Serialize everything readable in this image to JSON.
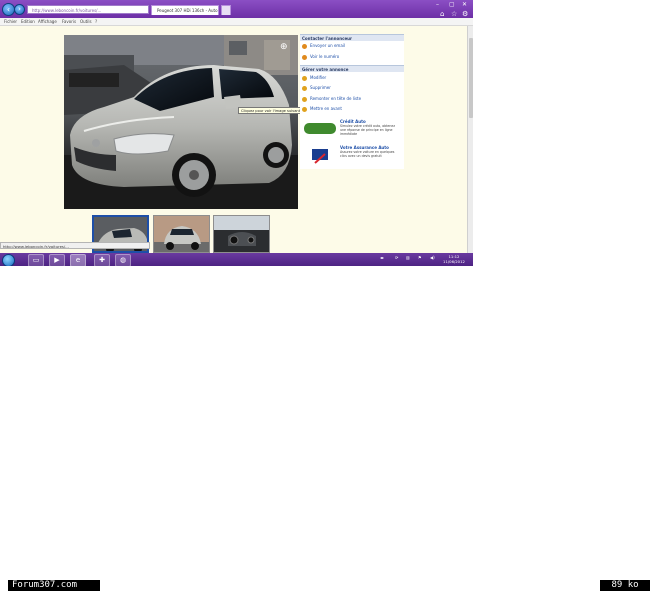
{
  "browser": {
    "address": "http://www.leboncoin.fr/voitures/...",
    "tabs": [
      {
        "label": "Peugeot 307 HDi 136ch - Auto"
      },
      {
        "label": ""
      }
    ],
    "window_controls": [
      "–",
      "▢",
      "✕"
    ]
  },
  "menu": [
    "Fichier",
    "Edition",
    "Affichage",
    "Favoris",
    "Outils",
    "?"
  ],
  "listing": {
    "tooltip": "Cliquez pour voir l'image suivante",
    "contact_header": "Contacter l'annonceur",
    "contact_links": [
      {
        "label": "Envoyer un email"
      },
      {
        "label": "Voir le numéro"
      }
    ],
    "manage_header": "Gérer votre annonce",
    "manage_links": [
      {
        "label": "Modifier"
      },
      {
        "label": "Supprimer"
      },
      {
        "label": "Remonter en tête de liste"
      },
      {
        "label": "Mettre en avant"
      }
    ],
    "ads": [
      {
        "title": "Crédit Auto",
        "text": "Simulez votre crédit auto, obtenez une réponse de principe en ligne immédiate",
        "logo_color": "#3f8a2e"
      },
      {
        "title": "Votre Assurance Auto",
        "text": "Assurez votre voiture en quelques clics avec un devis gratuit",
        "logo_color": "#1a3d8f"
      }
    ]
  },
  "status_bar": "http://www.leboncoin.fr/voitures/...",
  "taskbar": {
    "clock_time": "11:12",
    "clock_date": "11/06/2012"
  },
  "footer": {
    "site": "Forum307.com",
    "size": "89 ko"
  },
  "colors": {
    "chrome": "#7a3cb3",
    "page_bg": "#fdfbe8",
    "link": "#1e4fa8"
  }
}
